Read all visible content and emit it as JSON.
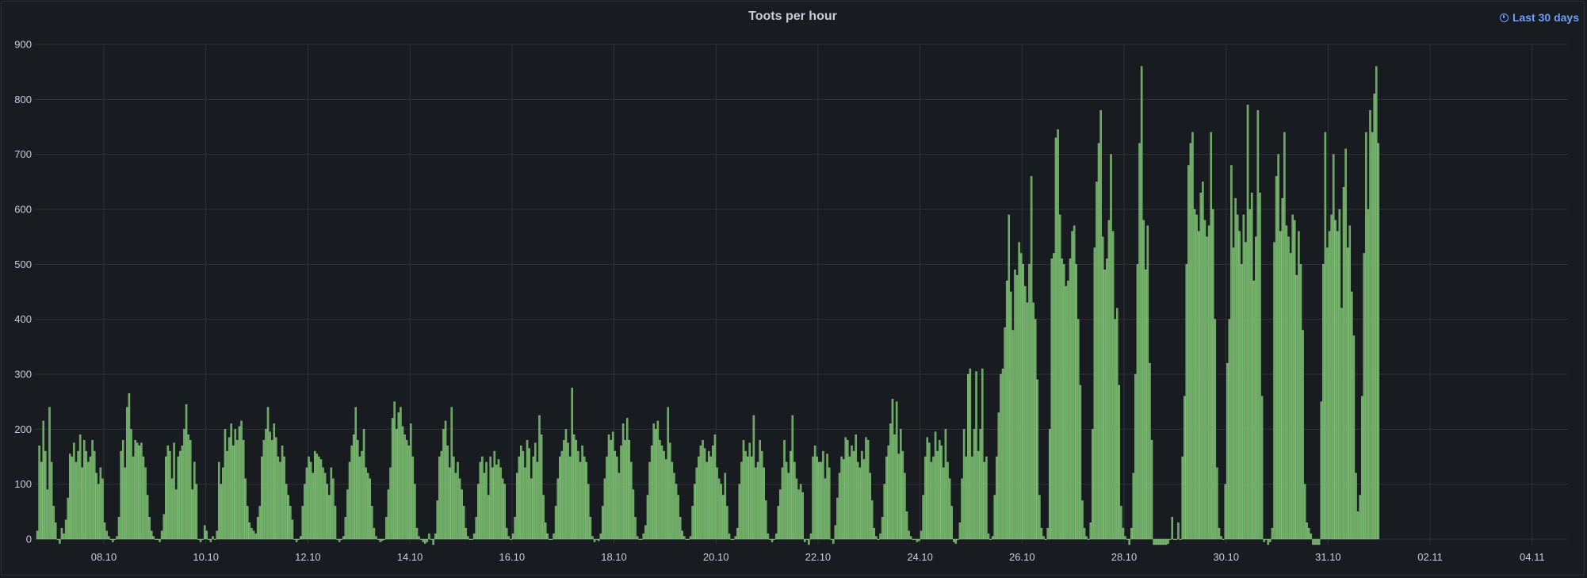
{
  "panel": {
    "title": "Toots per hour",
    "time_range_label": "Last 30 days",
    "icons": {
      "time_range": "clock-icon"
    }
  },
  "colors": {
    "bar": "#73bf69",
    "bar_edge": "#9ad08f",
    "grid": "#2f3238",
    "background": "#181b1f",
    "text": "#ccccdc",
    "accent": "#6e9fff"
  },
  "chart_data": {
    "type": "bar",
    "title": "Toots per hour",
    "xlabel": "",
    "ylabel": "",
    "ylim": [
      0,
      900
    ],
    "y_ticks": [
      0,
      100,
      200,
      300,
      400,
      500,
      600,
      700,
      800,
      900
    ],
    "x_tick_labels": [
      "08.10",
      "10.10",
      "12.10",
      "14.10",
      "16.10",
      "18.10",
      "20.10",
      "22.10",
      "24.10",
      "26.10",
      "28.10",
      "30.10",
      "31.10",
      "02.11",
      "04.11"
    ],
    "grid": true,
    "legend": "none",
    "bar_interval": "1 hour",
    "values": [
      15,
      170,
      140,
      215,
      160,
      90,
      240,
      140,
      60,
      30,
      0,
      -8,
      20,
      10,
      35,
      75,
      155,
      150,
      175,
      140,
      160,
      190,
      130,
      180,
      160,
      140,
      150,
      180,
      160,
      120,
      100,
      130,
      110,
      30,
      15,
      5,
      0,
      -5,
      0,
      5,
      40,
      160,
      180,
      130,
      240,
      265,
      200,
      150,
      180,
      175,
      170,
      175,
      150,
      130,
      80,
      40,
      15,
      5,
      0,
      0,
      -5,
      15,
      45,
      150,
      170,
      160,
      110,
      175,
      90,
      150,
      160,
      170,
      200,
      245,
      190,
      180,
      90,
      140,
      100,
      0,
      -5,
      0,
      25,
      15,
      0,
      -5,
      5,
      0,
      15,
      140,
      100,
      130,
      200,
      160,
      185,
      210,
      170,
      200,
      180,
      205,
      215,
      180,
      110,
      60,
      30,
      20,
      15,
      10,
      40,
      60,
      150,
      180,
      200,
      240,
      195,
      180,
      210,
      185,
      150,
      140,
      170,
      150,
      100,
      80,
      60,
      35,
      0,
      -5,
      0,
      5,
      60,
      100,
      130,
      150,
      140,
      120,
      160,
      155,
      150,
      145,
      130,
      120,
      100,
      80,
      130,
      110,
      60,
      0,
      -5,
      0,
      5,
      40,
      90,
      140,
      170,
      190,
      240,
      180,
      150,
      160,
      200,
      130,
      120,
      110,
      60,
      20,
      5,
      0,
      -5,
      -3,
      0,
      40,
      90,
      130,
      220,
      250,
      200,
      230,
      240,
      205,
      190,
      180,
      170,
      210,
      150,
      100,
      20,
      5,
      0,
      -5,
      -8,
      -5,
      10,
      0,
      -10,
      10,
      70,
      150,
      160,
      200,
      215,
      170,
      130,
      240,
      150,
      120,
      140,
      110,
      90,
      60,
      20,
      5,
      0,
      0,
      10,
      40,
      100,
      140,
      150,
      120,
      140,
      80,
      150,
      130,
      160,
      135,
      145,
      130,
      110,
      100,
      20,
      5,
      0,
      10,
      40,
      120,
      150,
      170,
      160,
      130,
      180,
      165,
      110,
      150,
      175,
      140,
      225,
      190,
      80,
      30,
      10,
      0,
      0,
      10,
      60,
      110,
      150,
      160,
      180,
      200,
      175,
      150,
      275,
      190,
      180,
      160,
      140,
      170,
      150,
      140,
      100,
      40,
      5,
      -5,
      0,
      -3,
      10,
      60,
      110,
      150,
      190,
      180,
      195,
      160,
      150,
      120,
      170,
      210,
      180,
      220,
      180,
      140,
      90,
      40,
      5,
      0,
      0,
      10,
      25,
      80,
      140,
      170,
      210,
      200,
      215,
      180,
      170,
      160,
      145,
      240,
      175,
      140,
      120,
      100,
      80,
      40,
      15,
      5,
      0,
      0,
      5,
      60,
      100,
      130,
      150,
      170,
      180,
      165,
      140,
      160,
      150,
      170,
      190,
      130,
      110,
      100,
      80,
      120,
      60,
      10,
      0,
      0,
      5,
      20,
      100,
      140,
      180,
      160,
      150,
      175,
      150,
      225,
      130,
      140,
      180,
      160,
      130,
      70,
      10,
      0,
      -5,
      0,
      10,
      60,
      90,
      130,
      180,
      140,
      120,
      160,
      225,
      140,
      110,
      90,
      100,
      85,
      -5,
      0,
      -10,
      10,
      150,
      170,
      150,
      140,
      140,
      160,
      110,
      155,
      130,
      0,
      -8,
      25,
      75,
      120,
      150,
      145,
      185,
      180,
      150,
      170,
      160,
      190,
      140,
      130,
      160,
      145,
      185,
      180,
      120,
      70,
      20,
      5,
      0,
      10,
      40,
      100,
      150,
      170,
      210,
      255,
      190,
      250,
      155,
      200,
      160,
      120,
      50,
      15,
      5,
      0,
      0,
      -5,
      -3,
      15,
      80,
      150,
      185,
      175,
      140,
      150,
      195,
      160,
      180,
      170,
      130,
      200,
      140,
      110,
      60,
      -5,
      -8,
      0,
      30,
      110,
      200,
      150,
      300,
      310,
      150,
      200,
      305,
      160,
      200,
      310,
      140,
      150,
      10,
      0,
      5,
      80,
      150,
      230,
      300,
      310,
      385,
      470,
      590,
      450,
      380,
      490,
      480,
      540,
      520,
      500,
      460,
      430,
      500,
      660,
      430,
      400,
      290,
      80,
      20,
      5,
      0,
      20,
      200,
      510,
      520,
      730,
      745,
      590,
      510,
      500,
      460,
      470,
      510,
      560,
      570,
      500,
      400,
      280,
      70,
      20,
      5,
      0,
      30,
      200,
      530,
      650,
      720,
      780,
      550,
      490,
      510,
      580,
      700,
      560,
      400,
      420,
      280,
      60,
      20,
      5,
      0,
      -10,
      20,
      120,
      300,
      500,
      720,
      860,
      580,
      490,
      570,
      320,
      180,
      -10,
      -10,
      -10,
      -10,
      -10,
      -10,
      -10,
      -8,
      0,
      40,
      0,
      0,
      30,
      0,
      150,
      260,
      500,
      680,
      720,
      740,
      600,
      590,
      560,
      630,
      650,
      580,
      550,
      570,
      740,
      600,
      400,
      130,
      20,
      5,
      0,
      100,
      320,
      400,
      680,
      530,
      620,
      590,
      560,
      500,
      590,
      540,
      790,
      600,
      630,
      470,
      550,
      780,
      630,
      260,
      -5,
      0,
      -10,
      -5,
      20,
      540,
      660,
      700,
      560,
      620,
      740,
      570,
      550,
      520,
      590,
      580,
      480,
      560,
      500,
      380,
      100,
      30,
      20,
      10,
      -10,
      -10,
      -10,
      -10,
      250,
      500,
      740,
      530,
      560,
      590,
      700,
      580,
      560,
      600,
      420,
      640,
      710,
      530,
      570,
      450,
      370,
      120,
      50,
      80,
      260,
      520,
      740,
      600,
      780,
      740,
      810,
      860,
      720
    ]
  }
}
